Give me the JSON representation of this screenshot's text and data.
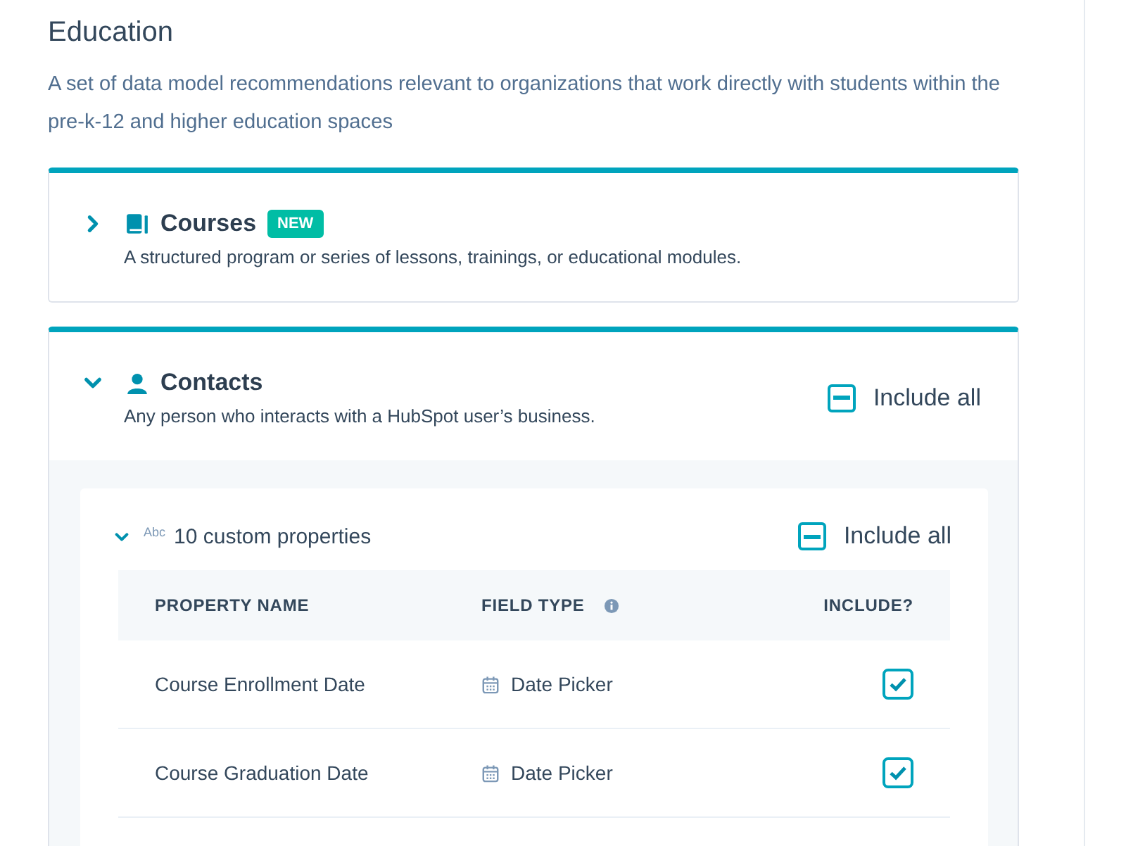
{
  "section": {
    "title": "Education",
    "description": "A set of data model recommendations relevant to organizations that work directly with students within the pre-k-12 and higher education spaces"
  },
  "objects": [
    {
      "name": "Courses",
      "kind": "book",
      "badge": "NEW",
      "description": "A structured program or series of lessons, trainings, or educational modules.",
      "expanded": false
    },
    {
      "name": "Contacts",
      "kind": "person",
      "description": "Any person who interacts with a HubSpot user’s business.",
      "expanded": true,
      "include_all": {
        "label": "Include all",
        "indeterminate": true
      },
      "groups": [
        {
          "icon_text": "Abc",
          "label": "10 custom properties",
          "expanded": true,
          "include_all": {
            "label": "Include all",
            "indeterminate": true
          },
          "table": {
            "columns": [
              "PROPERTY NAME",
              "FIELD TYPE",
              "INCLUDE?"
            ],
            "rows": [
              {
                "name": "Course Enrollment Date",
                "field_type": "Date Picker",
                "checked": true
              },
              {
                "name": "Course Graduation Date",
                "field_type": "Date Picker",
                "checked": true
              }
            ]
          }
        }
      ]
    }
  ]
}
